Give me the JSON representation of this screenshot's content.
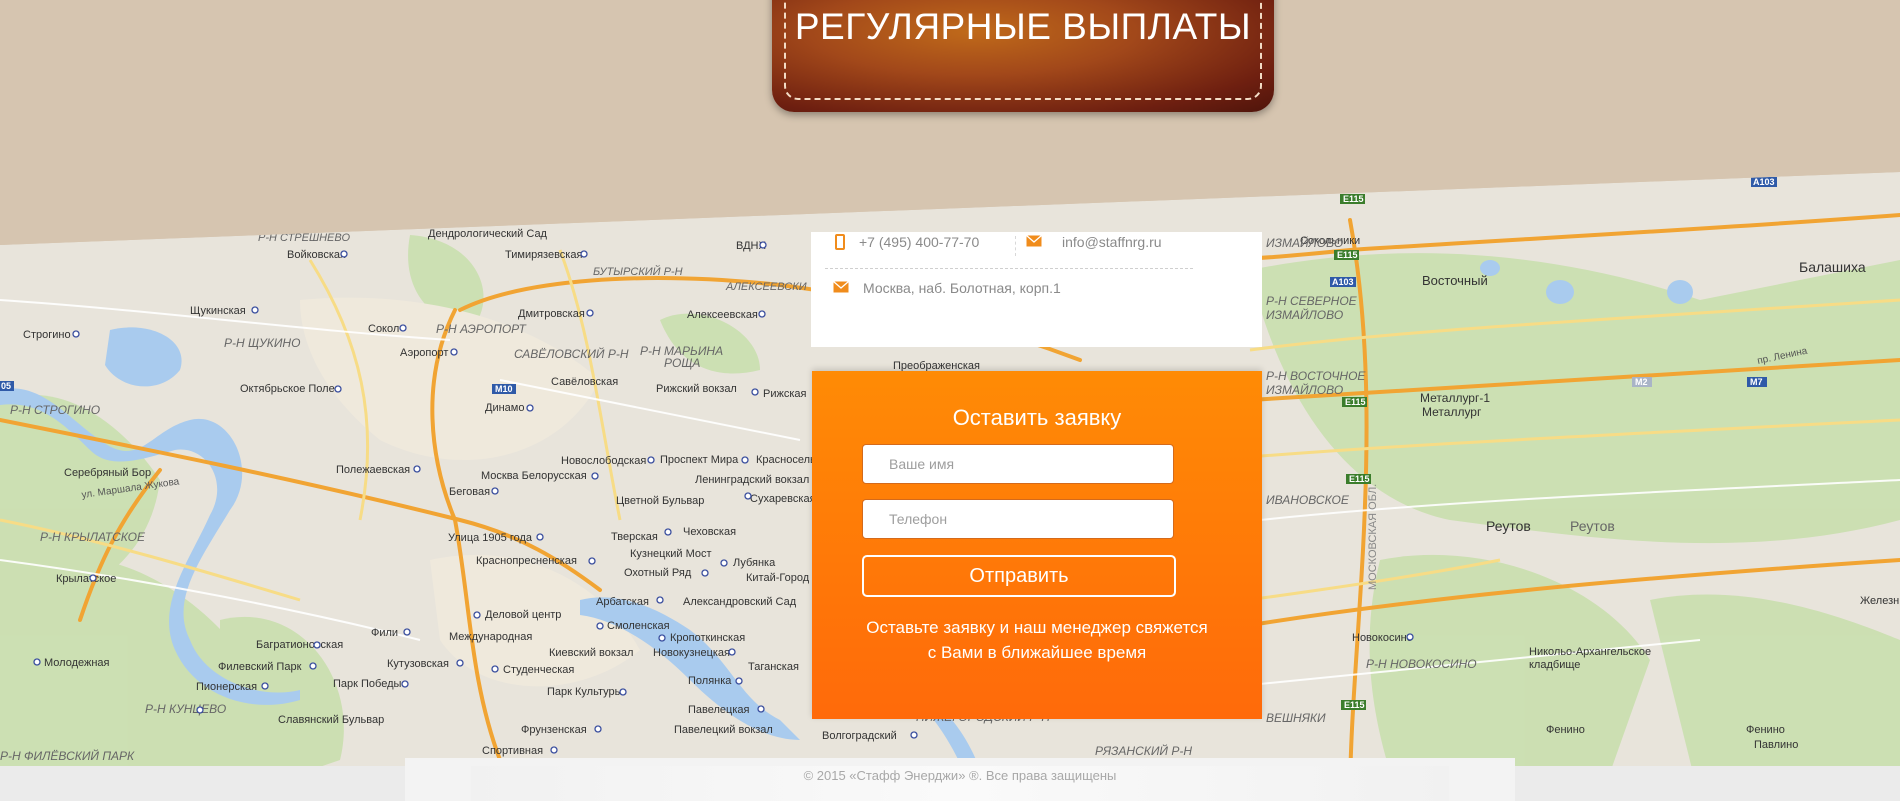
{
  "banner": {
    "title": "РЕГУЛЯРНЫЕ ВЫПЛАТЫ"
  },
  "contacts": {
    "phone": "+7 (495) 400-77-70",
    "email": "info@staffnrg.ru",
    "address": "Москва, наб. Болотная, корп.1",
    "icons": {
      "phone": "mobile-phone-icon",
      "email": "envelope-icon",
      "address": "envelope-icon"
    }
  },
  "form": {
    "title": "Оставить заявку",
    "name_placeholder": "Ваше имя",
    "phone_placeholder": "Телефон",
    "submit_label": "Отправить",
    "note_line1": "Оставьте заявку и наш менеджер свяжется",
    "note_line2": "с Вами в ближайшее время"
  },
  "map": {
    "labels": [
      "Р-Н СТРЕШНЕВО",
      "Дендрологический Сад",
      "Войковская",
      "Тимирязевская",
      "БУТЫРСКИЙ Р-Н",
      "ВДНХ",
      "АЛЕКСЕЕВСКИ",
      "Щукинская",
      "Дмитровская",
      "Алексеевская",
      "Р-Н ЩУКИНО",
      "Сокол",
      "Р-Н АЭРОПОРТ",
      "Строгино",
      "Аэропорт",
      "САВЁЛОВСКИЙ Р-Н",
      "Р-Н МАРЬИНА РОЩА",
      "Октябрьское Поле",
      "Савёловская",
      "Рижский вокзал",
      "Рижская",
      "Динамо",
      "Р-Н СТРОГИНО",
      "Серебряный Бор",
      "Полежаевская",
      "Москва Белорусская",
      "Новослободская",
      "Проспект Мира",
      "Красносельская",
      "Беговая",
      "Ленинградский вокзал",
      "Цветной Бульвар",
      "Сухаревская",
      "Р-Н КРЫЛАТСКОЕ",
      "Улица 1905 года",
      "Тверская",
      "Чеховская",
      "Краснопресненская",
      "Кузнецкий Мост",
      "Лубянка",
      "Охотный Ряд",
      "Китай-Город",
      "Крылатское",
      "Арбатская",
      "Александровский Сад",
      "Деловой центр",
      "Смоленская",
      "Фили",
      "Международная",
      "Кропоткинская",
      "Багратионовская",
      "Киевский вокзал",
      "Новокузнецкая",
      "Филевский Парк",
      "Кутузовская",
      "Студенческая",
      "Таганская",
      "Молодежная",
      "Парк Победы",
      "Полянка",
      "Пионерская",
      "Парк Культуры",
      "Р-Н КУНЦЕВО",
      "Славянский Бульвар",
      "Павелецкая",
      "Фрунзенская",
      "Павелецкий вокзал",
      "Спортивная",
      "Волгоградский",
      "Сокольники",
      "Преображенская",
      "Р-Н СЕВЕРНОЕ ИЗМАЙЛОВО",
      "Р-Н ВОСТОЧНОЕ ИЗМАЙЛОВО",
      "Восточный",
      "Балашиха",
      "Металлург-1",
      "Металлург",
      "ИВАНОВСКОЕ",
      "Реутов",
      "Новокосино",
      "Никольо-Архангельское кладбище",
      "Р-Н НОВОКОСИНО",
      "Железн",
      "Фенино",
      "Павлино",
      "РЯЗАНСКИЙ Р-Н",
      "ВЕШНЯКИ",
      "Р-Н ЛЕФОРТОВО",
      "МОСКОВСКАЯ ОБЛ.",
      "пр. Ленина",
      "ул. Маршала Жукова"
    ],
    "road_badges": [
      "E115",
      "A103",
      "M7",
      "M10",
      "M2",
      "05"
    ]
  },
  "footer": {
    "copyright": "© 2015 «Стафф Энерджи» ®. Все права защищены"
  }
}
